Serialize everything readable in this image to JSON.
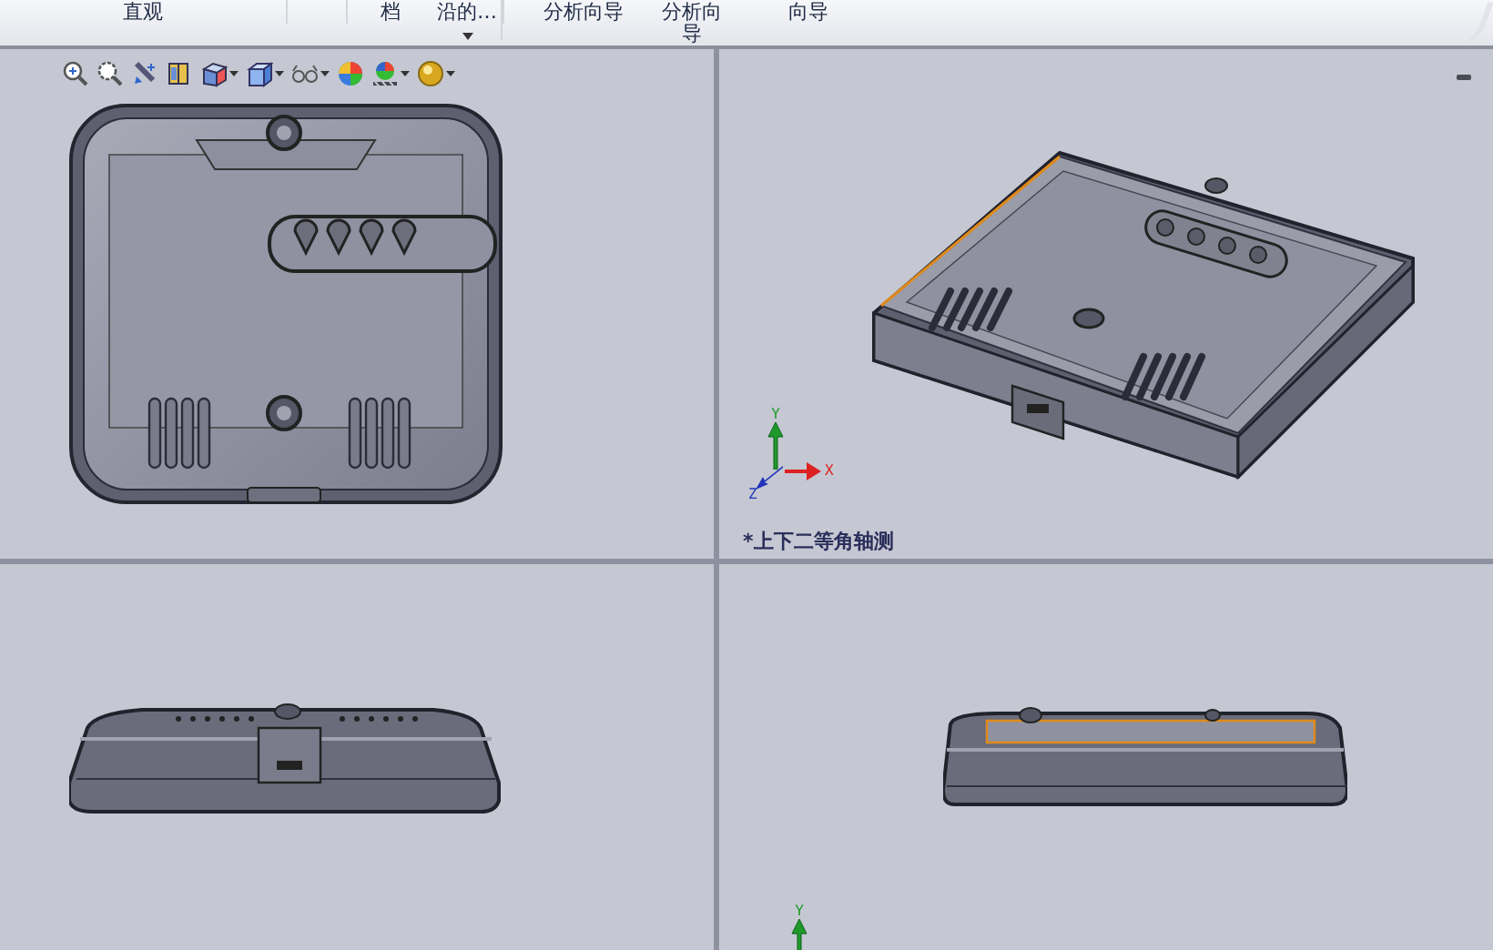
{
  "ribbon": {
    "items": [
      {
        "label": "直观",
        "dropdown": false,
        "wrapped": false,
        "group_end": true
      },
      {
        "label": "档",
        "dropdown": false,
        "wrapped": false,
        "group_end": false
      },
      {
        "label": "沿的…",
        "dropdown": true,
        "wrapped": false,
        "group_end": true
      },
      {
        "label": "分析向导",
        "dropdown": false,
        "wrapped": false,
        "group_end": false
      },
      {
        "label": "分析向导",
        "dropdown": false,
        "wrapped": true,
        "group_end": false
      },
      {
        "label": "向导",
        "dropdown": false,
        "wrapped": false,
        "group_end": false
      }
    ]
  },
  "view_toolbar": {
    "tools": [
      {
        "kind": "zoom-fit",
        "dropdown": false
      },
      {
        "kind": "zoom-area",
        "dropdown": false
      },
      {
        "kind": "previous",
        "dropdown": false
      },
      {
        "kind": "section",
        "dropdown": false
      },
      {
        "kind": "orientation",
        "dropdown": true
      },
      {
        "kind": "display-style",
        "dropdown": true
      },
      {
        "kind": "hide-show",
        "dropdown": true
      },
      {
        "kind": "appearance",
        "dropdown": false
      },
      {
        "kind": "scene",
        "dropdown": true
      },
      {
        "kind": "realview",
        "dropdown": true
      }
    ]
  },
  "viewports": [
    {
      "kind": "top"
    },
    {
      "kind": "iso",
      "label": "*上下二等角轴测",
      "triad": {
        "x": "X",
        "y": "Y",
        "z": "Z"
      }
    },
    {
      "kind": "front"
    },
    {
      "kind": "side",
      "triad": {
        "y": "Y"
      }
    }
  ]
}
